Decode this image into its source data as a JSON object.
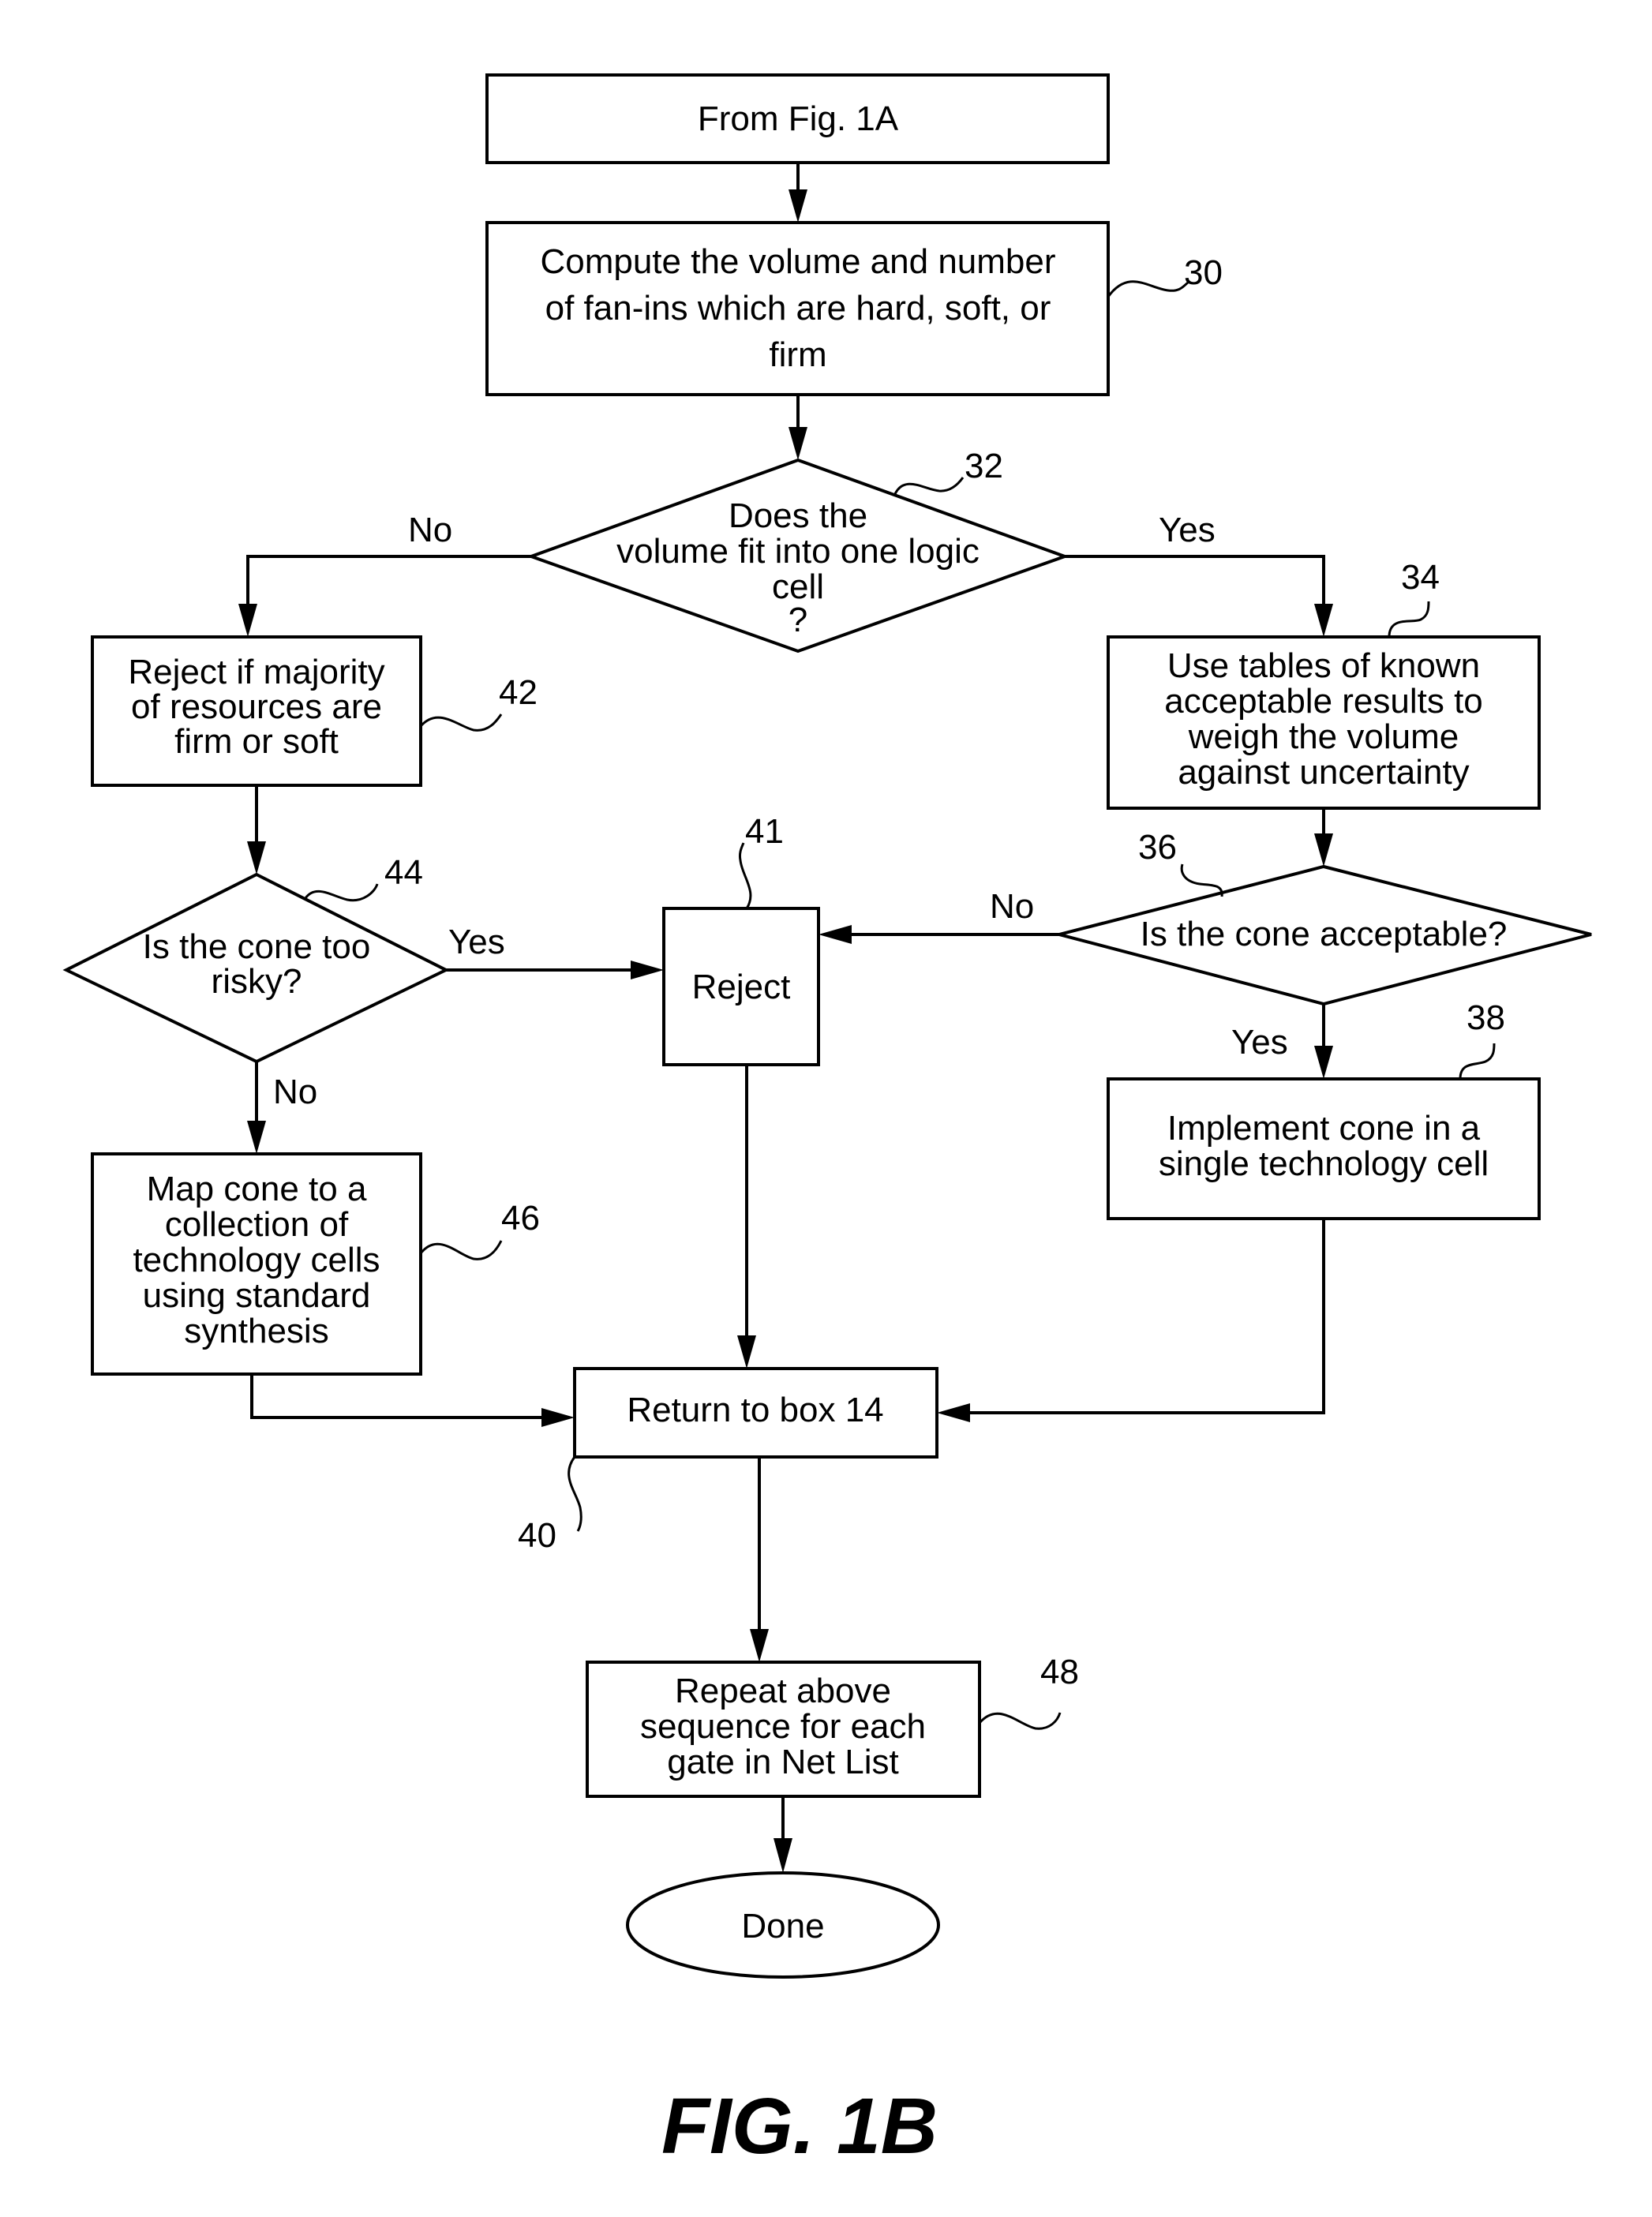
{
  "figure": {
    "caption": "FIG. 1B",
    "line_color": "#000000",
    "background": "#ffffff"
  },
  "nodes": {
    "start": {
      "type": "process",
      "lines": [
        "From Fig. 1A"
      ]
    },
    "n30": {
      "type": "process",
      "ref": "30",
      "lines": [
        "Compute the volume and number",
        "of fan-ins which are hard, soft, or",
        "firm"
      ]
    },
    "n32": {
      "type": "decision",
      "ref": "32",
      "lines": [
        "Does the",
        "volume fit into one logic",
        "cell",
        "?"
      ]
    },
    "n42": {
      "type": "process",
      "ref": "42",
      "lines": [
        "Reject if majority",
        "of resources are",
        "firm or soft"
      ]
    },
    "n34": {
      "type": "process",
      "ref": "34",
      "lines": [
        "Use tables of known",
        "acceptable results to",
        "weigh the volume",
        "against uncertainty"
      ]
    },
    "n44": {
      "type": "decision",
      "ref": "44",
      "lines": [
        "Is the cone too",
        "risky?"
      ]
    },
    "n41": {
      "type": "process",
      "ref": "41",
      "lines": [
        "Reject"
      ]
    },
    "n36": {
      "type": "decision",
      "ref": "36",
      "lines": [
        "Is the cone acceptable?"
      ]
    },
    "n38": {
      "type": "process",
      "ref": "38",
      "lines": [
        "Implement cone in a",
        "single technology cell"
      ]
    },
    "n46": {
      "type": "process",
      "ref": "46",
      "lines": [
        "Map cone to a",
        "collection of",
        "technology cells",
        "using standard",
        "synthesis"
      ]
    },
    "n40": {
      "type": "process",
      "ref": "40",
      "lines": [
        "Return to box 14"
      ]
    },
    "n48": {
      "type": "process",
      "ref": "48",
      "lines": [
        "Repeat above",
        "sequence for each",
        "gate in Net List"
      ]
    },
    "done": {
      "type": "terminator",
      "lines": [
        "Done"
      ]
    }
  },
  "edges": [
    {
      "from": "start",
      "to": "n30",
      "label": ""
    },
    {
      "from": "n30",
      "to": "n32",
      "label": ""
    },
    {
      "from": "n32",
      "to": "n42",
      "label": "No"
    },
    {
      "from": "n32",
      "to": "n34",
      "label": "Yes"
    },
    {
      "from": "n42",
      "to": "n44",
      "label": ""
    },
    {
      "from": "n44",
      "to": "n41",
      "label": "Yes"
    },
    {
      "from": "n44",
      "to": "n46",
      "label": "No"
    },
    {
      "from": "n34",
      "to": "n36",
      "label": ""
    },
    {
      "from": "n36",
      "to": "n41",
      "label": "No"
    },
    {
      "from": "n36",
      "to": "n38",
      "label": "Yes"
    },
    {
      "from": "n41",
      "to": "n40",
      "label": ""
    },
    {
      "from": "n46",
      "to": "n40",
      "label": ""
    },
    {
      "from": "n38",
      "to": "n40",
      "label": ""
    },
    {
      "from": "n40",
      "to": "n48",
      "label": ""
    },
    {
      "from": "n48",
      "to": "done",
      "label": ""
    }
  ]
}
